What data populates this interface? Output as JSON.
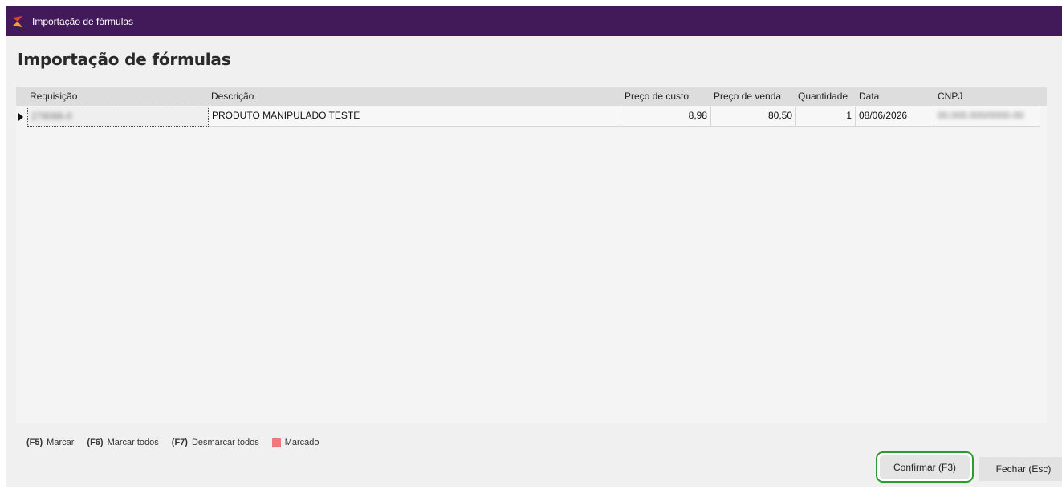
{
  "window": {
    "title": "Importação de fórmulas"
  },
  "page": {
    "title": "Importação de fórmulas"
  },
  "table": {
    "columns": [
      "Requisição",
      "Descrição",
      "Preço de custo",
      "Preço de venda",
      "Quantidade",
      "Data",
      "CNPJ"
    ],
    "rows": [
      {
        "requisicao": "278086-0",
        "descricao": "PRODUTO MANIPULADO TESTE",
        "preco_custo": "8,98",
        "preco_venda": "80,50",
        "quantidade": "1",
        "data": "08/06/2026",
        "cnpj": "00.000.000/0000-00"
      }
    ]
  },
  "legend": {
    "f5_key": "(F5)",
    "f5_label": "Marcar",
    "f6_key": "(F6)",
    "f6_label": "Marcar todos",
    "f7_key": "(F7)",
    "f7_label": "Desmarcar todos",
    "marked_label": "Marcado",
    "marked_color": "#f07a7a"
  },
  "buttons": {
    "confirm": "Confirmar (F3)",
    "close": "Fechar (Esc)"
  },
  "colors": {
    "titlebar": "#421a5a",
    "confirm_highlight": "#2f9a2f"
  }
}
